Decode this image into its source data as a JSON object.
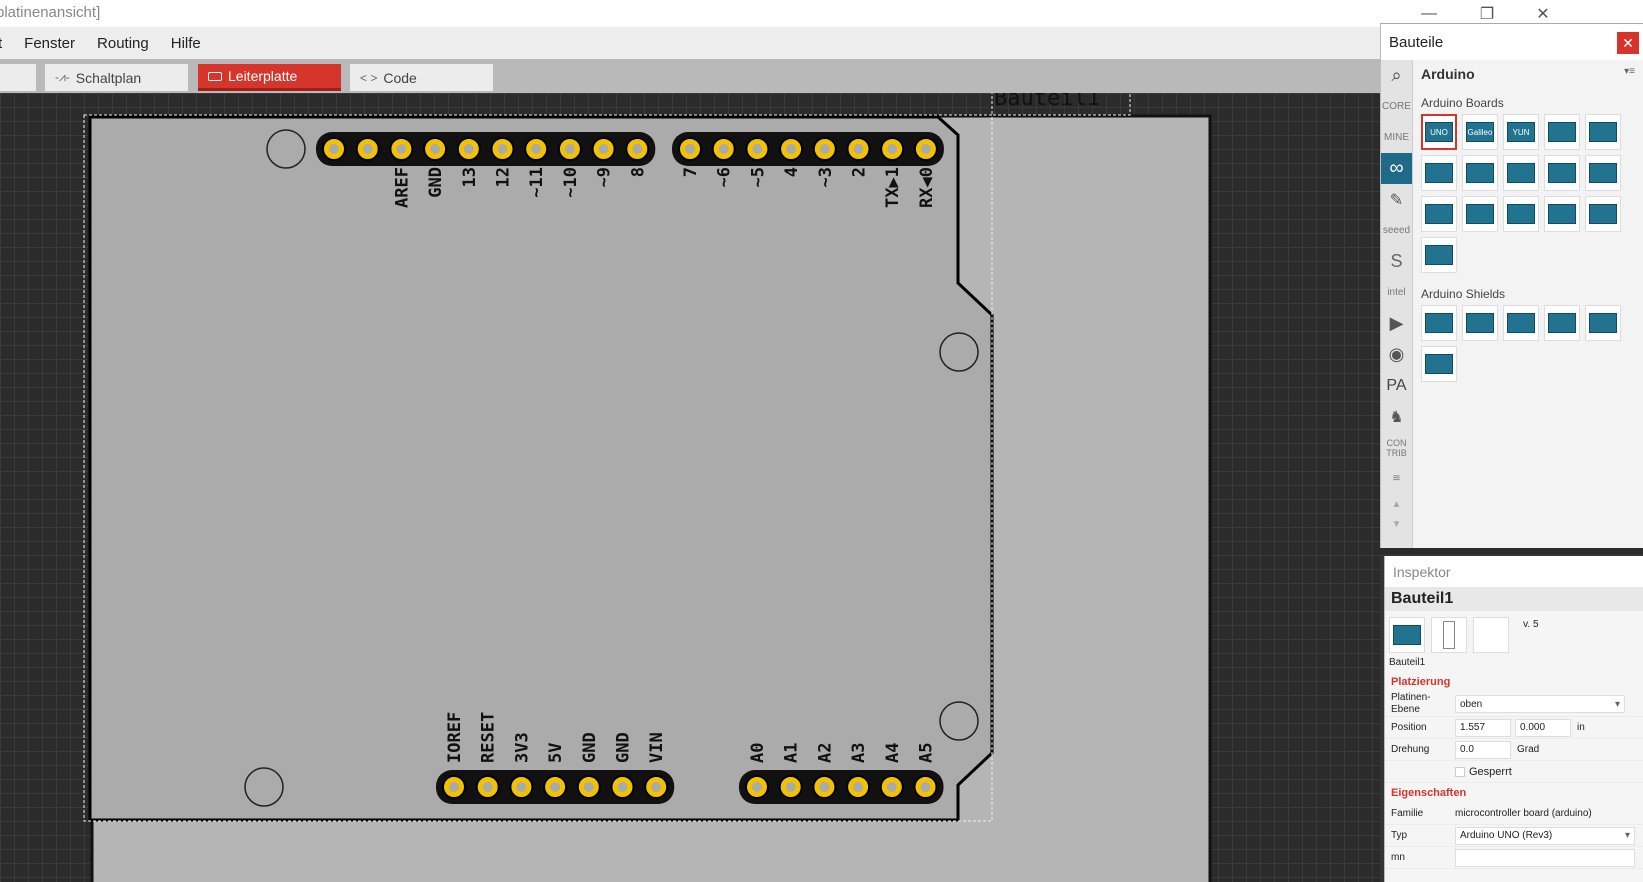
{
  "window": {
    "title": "platinenansicht]",
    "controls": {
      "minimize": "—",
      "restore": "❐",
      "close": "✕"
    }
  },
  "menu": {
    "items": [
      "t",
      "Fenster",
      "Routing",
      "Hilfe"
    ]
  },
  "tabs": [
    {
      "label": "Schaltplan",
      "active": false
    },
    {
      "label": "Leiterplatte",
      "active": true
    },
    {
      "label": "Code",
      "active": false
    }
  ],
  "pcb": {
    "part_label": "Bauteil1",
    "top_pins_left": [
      "AREF",
      "GND",
      "13",
      "12",
      "~11",
      "~10",
      "~9",
      "8"
    ],
    "top_pins_right": [
      "7",
      "~6",
      "~5",
      "4",
      "~3",
      "2",
      "TX▶1",
      "RX◀0"
    ],
    "bottom_pins_left": [
      "IOREF",
      "RESET",
      "3V3",
      "5V",
      "GND",
      "GND",
      "VIN"
    ],
    "bottom_pins_right": [
      "A0",
      "A1",
      "A2",
      "A3",
      "A4",
      "A5"
    ]
  },
  "parts_panel": {
    "title": "Bauteile",
    "close": "✕",
    "bins": [
      "search-icon",
      "CORE",
      "MINE",
      "∞",
      "✎",
      "seeed",
      "S",
      "intel",
      "▶",
      "◉",
      "PA",
      "♞",
      "CON TRIB",
      "≋",
      "▲",
      "▼"
    ],
    "bin_title": "Arduino",
    "bin_menu": "▾≡",
    "sections": [
      {
        "title": "Arduino Boards",
        "tiles": [
          "UNO",
          "Galileo",
          "YUN",
          "",
          "",
          "",
          "",
          "",
          "",
          "",
          "",
          "",
          "",
          "",
          "",
          ""
        ]
      },
      {
        "title": "Arduino Shields",
        "tiles": [
          "",
          "",
          "",
          "",
          "",
          ""
        ]
      }
    ]
  },
  "inspector": {
    "title": "Inspektor",
    "part_name": "Bauteil1",
    "image_caption": "Bauteil1",
    "version": "v. 5",
    "placement_title": "Platzierung",
    "layer_label": "Platinen-\nEbene",
    "layer_value": "oben",
    "position_label": "Position",
    "pos_x": "1.557",
    "pos_y": "0.000",
    "unit": "in",
    "rotation_label": "Drehung",
    "rotation_value": "0.0",
    "rotation_unit": "Grad",
    "locked_label": "Gesperrt",
    "properties_title": "Eigenschaften",
    "family_label": "Familie",
    "family_value": "microcontroller board (arduino)",
    "type_label": "Typ",
    "type_value": "Arduino UNO (Rev3)",
    "mn_label": "mn"
  },
  "colors": {
    "accent": "#d5352b",
    "bin_active": "#1e6a87",
    "pad_ring": "#f2c200",
    "board_fill": "#b3b3b3"
  }
}
